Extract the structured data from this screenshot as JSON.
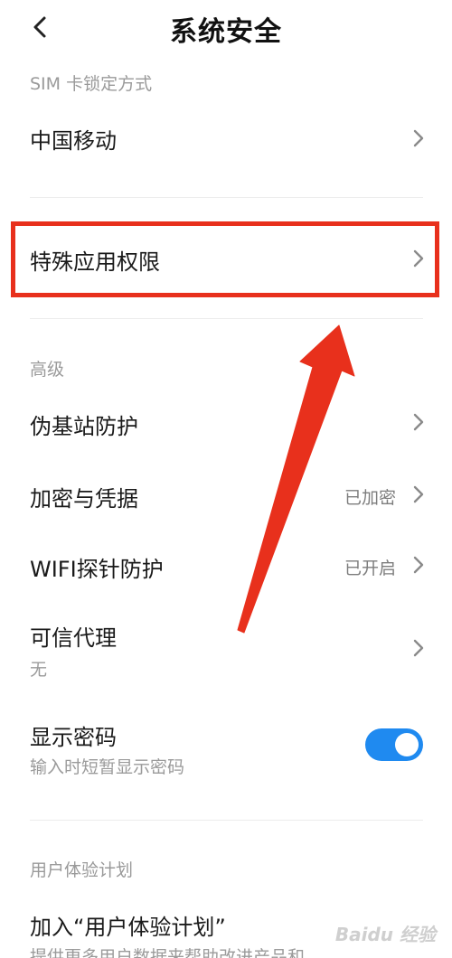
{
  "header": {
    "title": "系统安全"
  },
  "sim_section": {
    "label": "SIM 卡锁定方式",
    "items": [
      {
        "title": "中国移动"
      }
    ]
  },
  "special_permissions": {
    "title": "特殊应用权限"
  },
  "advanced_section": {
    "label": "高级",
    "items": [
      {
        "title": "伪基站防护"
      },
      {
        "title": "加密与凭据",
        "value": "已加密"
      },
      {
        "title": "WIFI探针防护",
        "value": "已开启"
      },
      {
        "title": "可信代理",
        "subtitle": "无"
      },
      {
        "title": "显示密码",
        "subtitle": "输入时短暂显示密码",
        "toggle_on": true
      }
    ]
  },
  "ux_section": {
    "label": "用户体验计划",
    "items": [
      {
        "title": "加入“用户体验计划”",
        "subtitle": "提供更多用户数据来帮助改进产品和"
      }
    ]
  },
  "watermark": "Baidu 经验",
  "colors": {
    "accent": "#1f8af0",
    "highlight": "#e8301c",
    "arrow": "#e8301c"
  }
}
